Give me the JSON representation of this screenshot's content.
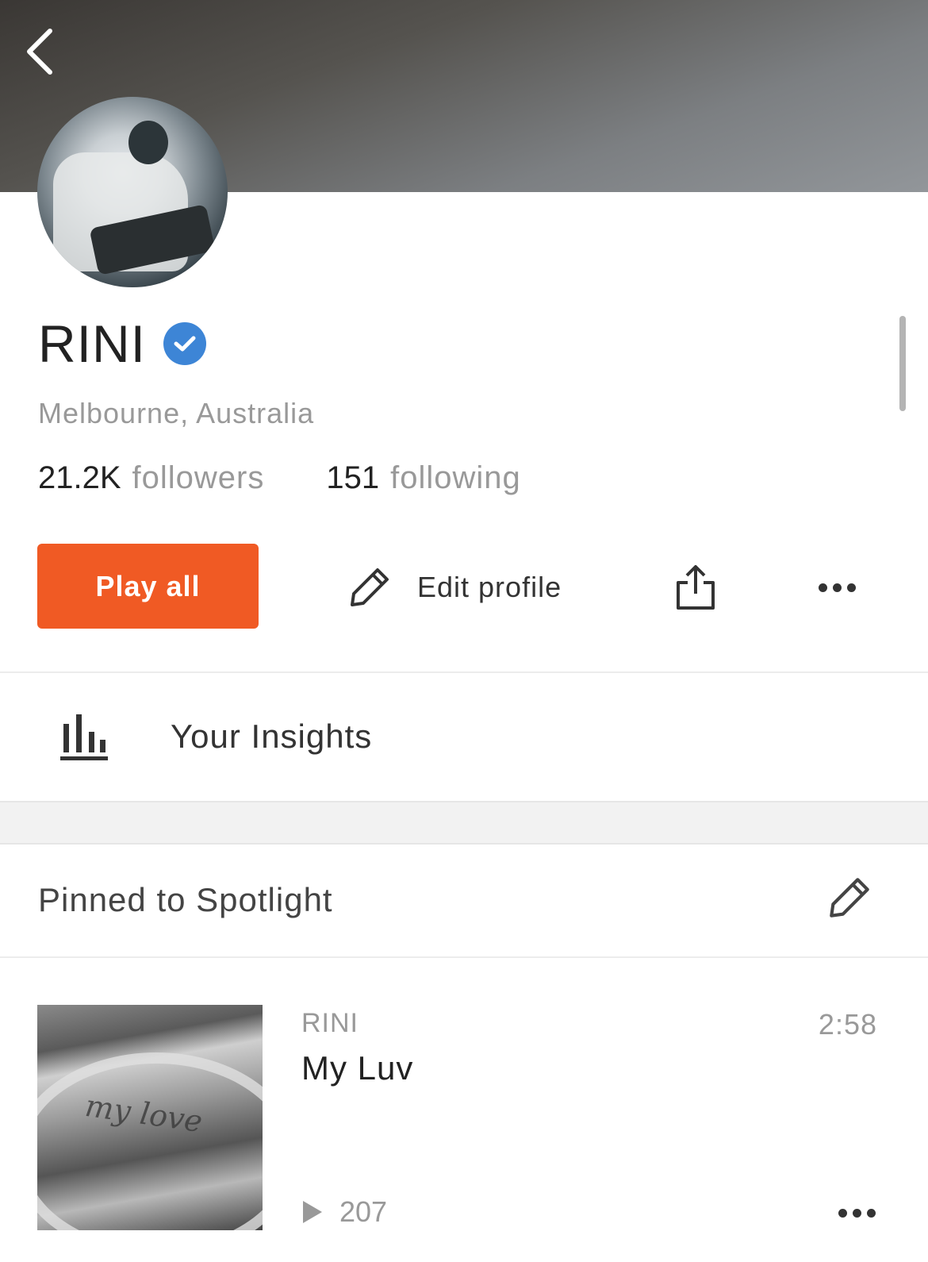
{
  "profile": {
    "name": "RINI",
    "location": "Melbourne, Australia",
    "followers_count": "21.2K",
    "followers_label": "followers",
    "following_count": "151",
    "following_label": "following"
  },
  "actions": {
    "play_all_label": "Play all",
    "edit_profile_label": "Edit profile"
  },
  "insights": {
    "label": "Your Insights"
  },
  "spotlight": {
    "title": "Pinned to Spotlight",
    "tracks": [
      {
        "artist": "RINI",
        "title": "My Luv",
        "duration": "2:58",
        "plays": "207",
        "artwork_text": "my love"
      }
    ]
  },
  "colors": {
    "accent": "#f05a24",
    "verified": "#3d85d6"
  },
  "icons": {
    "back": "chevron-left-icon",
    "verified": "verified-badge-icon",
    "edit": "pencil-icon",
    "share": "share-icon",
    "more": "more-icon",
    "insights": "bar-chart-icon",
    "play": "play-icon"
  }
}
